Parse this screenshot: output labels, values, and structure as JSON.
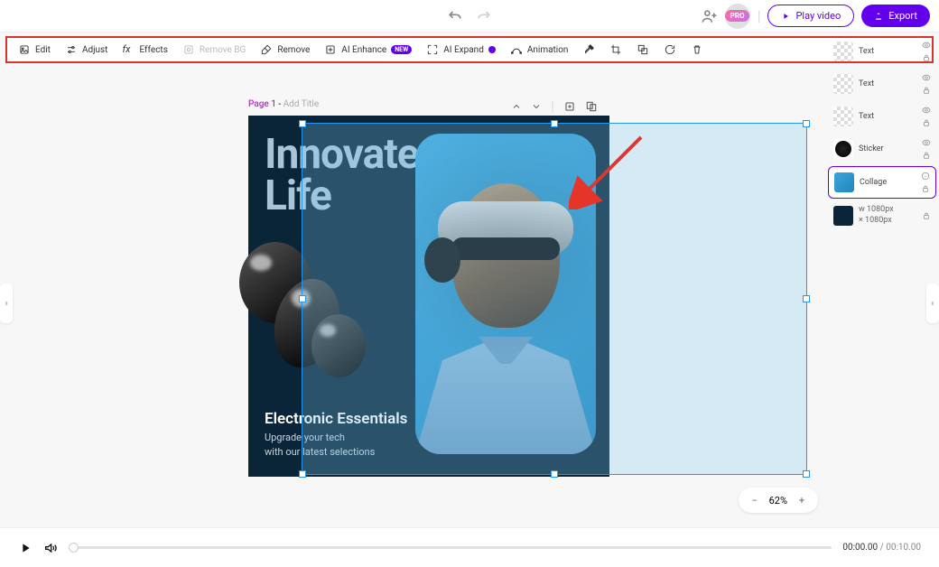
{
  "header": {
    "play_label": "Play video",
    "export_label": "Export",
    "pro_badge": "PRO"
  },
  "toolbar": {
    "edit": "Edit",
    "adjust": "Adjust",
    "effects": "Effects",
    "remove_bg": "Remove BG",
    "remove": "Remove",
    "ai_enhance": "AI Enhance",
    "ai_enhance_badge": "NEW",
    "ai_expand": "AI Expand",
    "animation": "Animation"
  },
  "page": {
    "number": "Page 1",
    "separator": " - ",
    "title_placeholder": "Add Title"
  },
  "canvas": {
    "headline_line1": "Innovate",
    "headline_line2": "Life",
    "subhead": "Electronic Essentials",
    "body1": "Upgrade your tech",
    "body2": "with our latest selections"
  },
  "layers": {
    "text_label": "Text",
    "sticker_label": "Sticker",
    "collage_label": "Collage",
    "size_w": "w  1080px",
    "size_h": "×  1080px"
  },
  "zoom": {
    "percent": "62%"
  },
  "player": {
    "current": "00:00.00",
    "total": "00:10.00",
    "separator": " / "
  }
}
